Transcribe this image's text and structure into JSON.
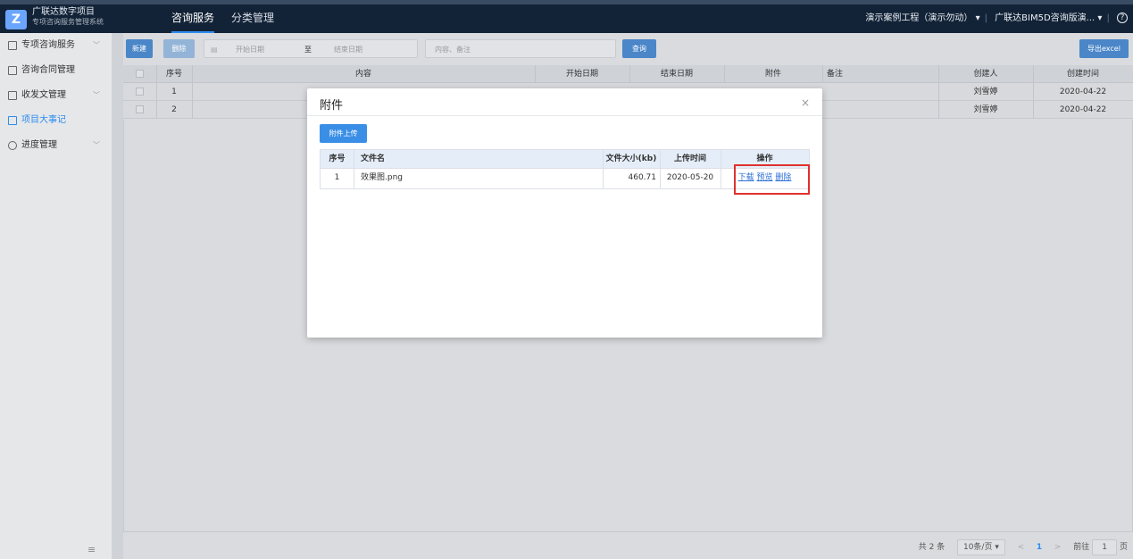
{
  "header": {
    "logo_letter": "Z",
    "app_title": "广联达数字项目",
    "app_subtitle": "专项咨询服务管理系统",
    "nav_tabs": [
      {
        "label": "咨询服务",
        "active": true
      },
      {
        "label": "分类管理",
        "active": false
      }
    ],
    "project_selector": "演示案例工程（演示勿动）",
    "org_selector": "广联达BIM5D咨询版演...",
    "help_icon": "question-circle-icon"
  },
  "sidebar": {
    "items": [
      {
        "label": "专项咨询服务",
        "icon": "document-icon",
        "has_submenu": true,
        "active": false
      },
      {
        "label": "咨询合同管理",
        "icon": "checkbox-icon",
        "has_submenu": false,
        "active": false
      },
      {
        "label": "收发文管理",
        "icon": "inbox-icon",
        "has_submenu": true,
        "active": false
      },
      {
        "label": "项目大事记",
        "icon": "notebook-icon",
        "has_submenu": false,
        "active": true
      },
      {
        "label": "进度管理",
        "icon": "clock-icon",
        "has_submenu": true,
        "active": false
      }
    ],
    "collapse_icon": "≡"
  },
  "toolbar": {
    "new_label": "新建",
    "delete_label": "删除",
    "start_date_placeholder": "开始日期",
    "date_separator": "至",
    "end_date_placeholder": "结束日期",
    "search_placeholder": "内容、备注",
    "query_label": "查询",
    "export_label": "导出excel"
  },
  "table": {
    "columns": [
      "序号",
      "内容",
      "开始日期",
      "结束日期",
      "附件",
      "备注",
      "创建人",
      "创建时间"
    ],
    "rows": [
      {
        "index": "1",
        "creator": "刘雪婷",
        "created": "2020-04-22"
      },
      {
        "index": "2",
        "creator": "刘雪婷",
        "created": "2020-04-22"
      }
    ]
  },
  "pagination": {
    "total": "共 2 条",
    "page_size": "10条/页",
    "prev": "<",
    "current_page": "1",
    "next": ">",
    "goto_label": "前往",
    "goto_value": "1",
    "page_suffix": "页"
  },
  "modal": {
    "title": "附件",
    "close": "×",
    "upload_label": "附件上传",
    "columns": [
      "序号",
      "文件名",
      "文件大小(kb)",
      "上传时间",
      "操作"
    ],
    "rows": [
      {
        "index": "1",
        "filename": "效果图.png",
        "size": "460.71",
        "uploaded": "2020-05-20",
        "actions": {
          "download": "下载",
          "preview": "预览",
          "delete": "删除"
        }
      }
    ]
  },
  "colors": {
    "accent": "#2d8cf0",
    "header_bg": "#132337",
    "highlight": "#e0302e"
  }
}
